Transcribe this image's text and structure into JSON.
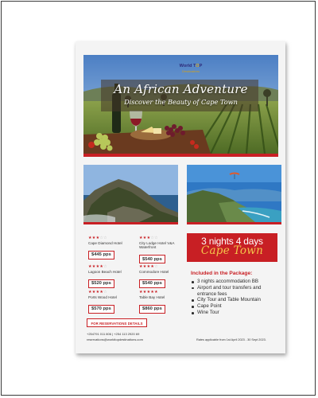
{
  "brand": {
    "name_part1": "World T",
    "name_o": "O",
    "name_part2": "P",
    "tagline": "Destinations"
  },
  "hero": {
    "title": "An African Adventure",
    "subtitle": "Discover the Beauty of Cape Town"
  },
  "hotels": [
    {
      "stars": 3,
      "name": "Cape Diamond Hotel",
      "price": "$445 pps"
    },
    {
      "stars": 3,
      "name": "City Lodge Hotel V&A Waterfront",
      "price": "$540 pps"
    },
    {
      "stars": 4,
      "name": "Lagoon Beach Hotel",
      "price": "$520 pps"
    },
    {
      "stars": 4,
      "name": "Commodore Hotel",
      "price": "$540 pps"
    },
    {
      "stars": 4,
      "name": "Ports Wood Hotel",
      "price": "$570 pps"
    },
    {
      "stars": 5,
      "name": "Table Bay Hotel",
      "price": "$860 pps"
    }
  ],
  "package": {
    "nights": "3 nights 4 days",
    "destination": "Cape Town",
    "included_title": "Included in the Package:",
    "items": [
      "3 nights accommodation BB",
      "Airport and tour transfers and entrance fees",
      "City Tour and Table Mountain",
      "Cape Point",
      "Wine Tour"
    ]
  },
  "reservations": {
    "label": "FOR RESERVATIONS DETAILS",
    "phones": "+254791 011 806 | +254 113 2920 69",
    "email": "reservations@worldtopdestinations.com"
  },
  "rates_note": "Rates applicable from 1st April 2023 - 30 Sept 2023.",
  "colors": {
    "accent_red": "#c81f24",
    "gold": "#f3c64b",
    "navy": "#2d2a7a"
  }
}
